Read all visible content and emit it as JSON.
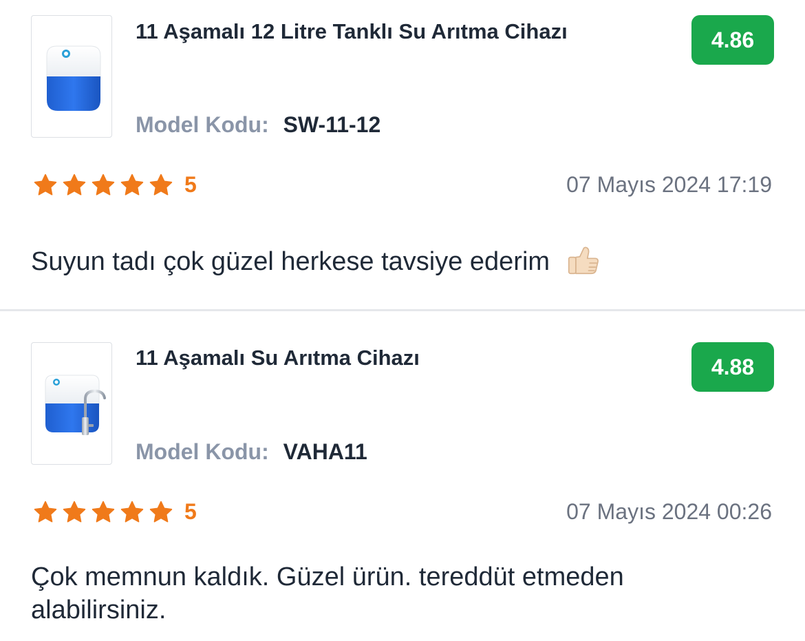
{
  "reviews": [
    {
      "product_name": "11 Aşamalı 12 Litre Tanklı Su Arıtma Cihazı",
      "score": "4.86",
      "model_label": "Model Kodu:",
      "model_code": "SW-11-12",
      "rating": "5",
      "date": "07 Mayıs 2024 17:19",
      "comment": "Suyun tadı çok güzel herkese tavsiye ederim",
      "comment_emoji": "thumbs-up-icon",
      "thumbnail": "water-purifier-tank-icon"
    },
    {
      "product_name": "11 Aşamalı Su Arıtma Cihazı",
      "score": "4.88",
      "model_label": "Model Kodu:",
      "model_code": "VAHA11",
      "rating": "5",
      "date": "07 Mayıs 2024 00:26",
      "comment": "Çok memnun kaldık. Güzel ürün. tereddüt etmeden alabilirsiniz.",
      "thumbnail": "water-purifier-faucet-icon"
    }
  ],
  "colors": {
    "score_badge": "#1aa84c",
    "star": "#f07a1a",
    "model_label": "#8a95a8",
    "date": "#6b7280"
  }
}
